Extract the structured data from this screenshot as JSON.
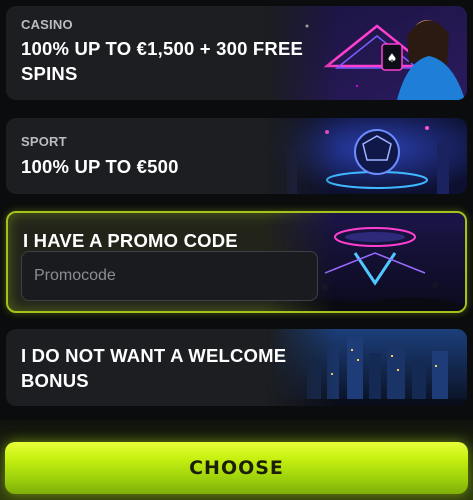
{
  "offers": {
    "casino": {
      "category": "CASINO",
      "headline": "100% UP TO €1,500 + 300 FREE SPINS"
    },
    "sport": {
      "category": "SPORT",
      "headline": "100% UP TO €500"
    },
    "promo": {
      "headline": "I HAVE A PROMO CODE",
      "input_placeholder": "Promocode",
      "input_value": ""
    },
    "none": {
      "headline": "I DO NOT WANT A WELCOME BONUS"
    }
  },
  "choose_button": {
    "label": "CHOOSE"
  },
  "colors": {
    "accent": "#c8f212",
    "card_bg": "#1c1e21",
    "selected_border": "#a3c21b",
    "page_bg": "#0b0c0d"
  },
  "images": {
    "casino": "casino-hostess-illustration",
    "sport": "football-arena-illustration",
    "promo": "stadium-stage-illustration",
    "none": "night-city-illustration"
  }
}
